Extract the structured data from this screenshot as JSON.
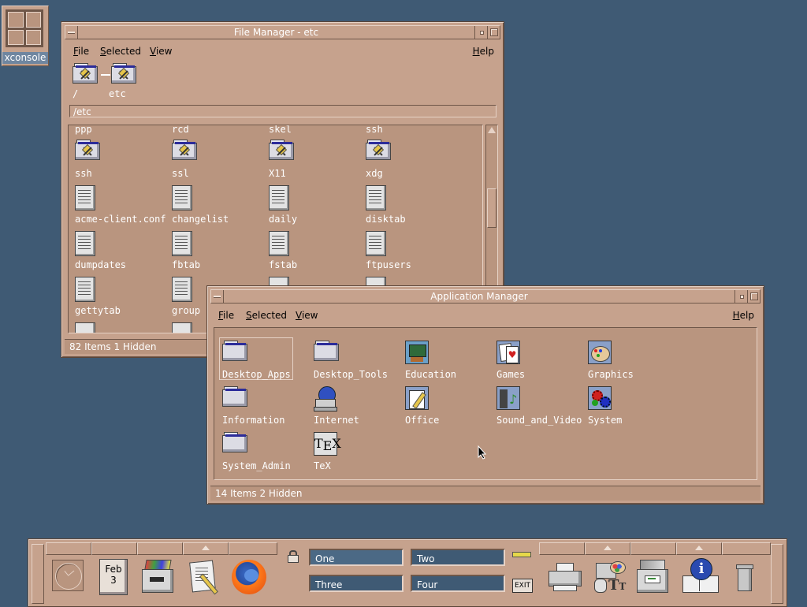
{
  "desktop": {
    "xconsole_label": "xconsole"
  },
  "file_manager": {
    "title": "File Manager - etc",
    "menu": {
      "file": "File",
      "selected": "Selected",
      "view": "View",
      "help": "Help"
    },
    "path_icons": [
      {
        "label": "/"
      },
      {
        "label": "etc"
      }
    ],
    "path_field": "/etc",
    "partial_top_row": [
      "ppp",
      "rcd",
      "skel",
      "ssh"
    ],
    "items": [
      {
        "label": "ssh",
        "type": "folder"
      },
      {
        "label": "ssl",
        "type": "folder"
      },
      {
        "label": "X11",
        "type": "folder"
      },
      {
        "label": "xdg",
        "type": "folder"
      },
      {
        "label": "acme-client.conf",
        "type": "doc"
      },
      {
        "label": "changelist",
        "type": "doc"
      },
      {
        "label": "daily",
        "type": "doc"
      },
      {
        "label": "disktab",
        "type": "doc"
      },
      {
        "label": "dumpdates",
        "type": "doc"
      },
      {
        "label": "fbtab",
        "type": "doc"
      },
      {
        "label": "fstab",
        "type": "doc"
      },
      {
        "label": "ftpusers",
        "type": "doc"
      },
      {
        "label": "gettytab",
        "type": "doc"
      },
      {
        "label": "group",
        "type": "doc"
      }
    ],
    "status": "82 Items 1 Hidden"
  },
  "app_manager": {
    "title": "Application Manager",
    "menu": {
      "file": "File",
      "selected": "Selected",
      "view": "View",
      "help": "Help"
    },
    "items": [
      {
        "label": "Desktop_Apps",
        "icon": "folder-icon"
      },
      {
        "label": "Desktop_Tools",
        "icon": "folder-icon"
      },
      {
        "label": "Education",
        "icon": "education-icon"
      },
      {
        "label": "Games",
        "icon": "cards-icon"
      },
      {
        "label": "Graphics",
        "icon": "palette-icon"
      },
      {
        "label": "Information",
        "icon": "folder-icon"
      },
      {
        "label": "Internet",
        "icon": "globe-computer-icon"
      },
      {
        "label": "Office",
        "icon": "pencil-doc-icon"
      },
      {
        "label": "Sound_and_Video",
        "icon": "film-music-icon"
      },
      {
        "label": "System",
        "icon": "gears-icon"
      },
      {
        "label": "System_Admin",
        "icon": "folder-icon"
      },
      {
        "label": "TeX",
        "icon": "tex-icon"
      }
    ],
    "status": "14 Items 2 Hidden"
  },
  "panel": {
    "calendar_month": "Feb",
    "calendar_day": "3",
    "workspaces": [
      "One",
      "Two",
      "Three",
      "Four"
    ],
    "exit_label": "EXIT"
  },
  "colors": {
    "desktop": "#3f5a74",
    "window": "#c6a28d",
    "workspace_button": "#3f5a74"
  }
}
